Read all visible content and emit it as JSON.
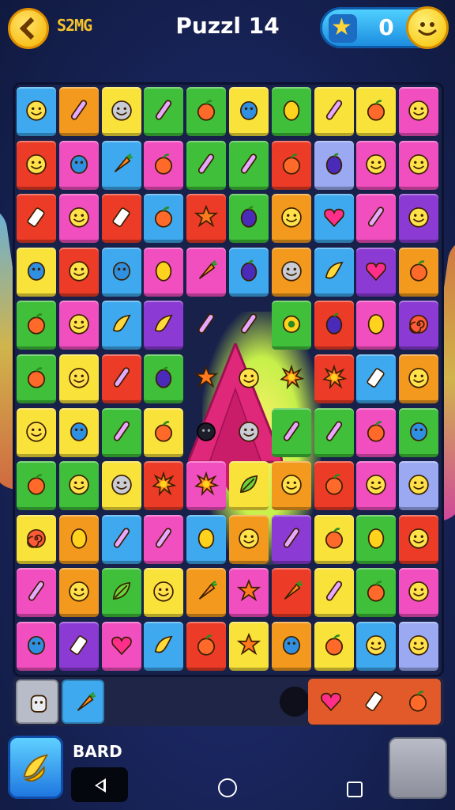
{
  "header": {
    "level_code": "S2MG",
    "title": "Puzzl 14",
    "score": "0"
  },
  "colors": {
    "blue": "#3ea9ee",
    "orange": "#f39a1e",
    "yellow": "#f9e23a",
    "green": "#3fbf3a",
    "red": "#ec3b26",
    "pink": "#f14fc0",
    "purple": "#8b3bd4",
    "lavender": "#9aa9f2",
    "gray": "#b8bcc8"
  },
  "board": {
    "rows": [
      [
        [
          "blue",
          "smiley"
        ],
        [
          "orange",
          "stick"
        ],
        [
          "yellow",
          "smiley-gray"
        ],
        [
          "green",
          "stick"
        ],
        [
          "green",
          "apple"
        ],
        [
          "yellow",
          "blob"
        ],
        [
          "green",
          "lemon"
        ],
        [
          "yellow",
          "stick"
        ],
        [
          "yellow",
          "apple"
        ],
        [
          "pink",
          "smiley"
        ]
      ],
      [
        [
          "red",
          "smiley"
        ],
        [
          "pink",
          "blob"
        ],
        [
          "blue",
          "carrot"
        ],
        [
          "pink",
          "apple"
        ],
        [
          "green",
          "stick"
        ],
        [
          "green",
          "stick"
        ],
        [
          "red",
          "apple"
        ],
        [
          "lavender",
          "plum"
        ],
        [
          "pink",
          "smiley"
        ],
        [
          "pink",
          "smiley"
        ]
      ],
      [
        [
          "red",
          "bottle"
        ],
        [
          "pink",
          "smiley"
        ],
        [
          "red",
          "bottle"
        ],
        [
          "blue",
          "apple"
        ],
        [
          "red",
          "star"
        ],
        [
          "green",
          "plum"
        ],
        [
          "orange",
          "smiley"
        ],
        [
          "blue",
          "heart"
        ],
        [
          "pink",
          "stick"
        ],
        [
          "purple",
          "smiley"
        ]
      ],
      [
        [
          "yellow",
          "blob"
        ],
        [
          "red",
          "smiley"
        ],
        [
          "blue",
          "blob"
        ],
        [
          "pink",
          "lemon"
        ],
        [
          "pink",
          "carrot"
        ],
        [
          "blue",
          "plum"
        ],
        [
          "orange",
          "smiley-gray"
        ],
        [
          "blue",
          "banana"
        ],
        [
          "purple",
          "heart"
        ],
        [
          "orange",
          "apple"
        ]
      ],
      [
        [
          "green",
          "apple"
        ],
        [
          "pink",
          "smiley"
        ],
        [
          "blue",
          "banana"
        ],
        [
          "purple",
          "banana"
        ],
        [
          "none",
          "stick"
        ],
        [
          "none",
          "stick"
        ],
        [
          "green",
          "eye"
        ],
        [
          "red",
          "plum"
        ],
        [
          "pink",
          "lemon"
        ],
        [
          "purple",
          "swirl"
        ]
      ],
      [
        [
          "green",
          "apple"
        ],
        [
          "yellow",
          "smiley"
        ],
        [
          "red",
          "stick"
        ],
        [
          "green",
          "plum"
        ],
        [
          "none",
          "star"
        ],
        [
          "none",
          "smiley"
        ],
        [
          "none",
          "flower"
        ],
        [
          "red",
          "flower"
        ],
        [
          "blue",
          "bottle"
        ],
        [
          "orange",
          "smiley"
        ]
      ],
      [
        [
          "yellow",
          "smiley"
        ],
        [
          "yellow",
          "blob"
        ],
        [
          "green",
          "stick"
        ],
        [
          "yellow",
          "apple"
        ],
        [
          "none",
          "bomb"
        ],
        [
          "none",
          "smiley-gray"
        ],
        [
          "green",
          "stick"
        ],
        [
          "green",
          "stick"
        ],
        [
          "pink",
          "apple"
        ],
        [
          "green",
          "blob"
        ]
      ],
      [
        [
          "green",
          "apple"
        ],
        [
          "green",
          "smiley"
        ],
        [
          "yellow",
          "smiley-gray"
        ],
        [
          "red",
          "flower"
        ],
        [
          "pink",
          "flower"
        ],
        [
          "yellow",
          "leaf"
        ],
        [
          "orange",
          "smiley"
        ],
        [
          "red",
          "apple"
        ],
        [
          "pink",
          "smiley"
        ],
        [
          "lavender",
          "smiley"
        ]
      ],
      [
        [
          "yellow",
          "swirl"
        ],
        [
          "orange",
          "lemon"
        ],
        [
          "blue",
          "stick"
        ],
        [
          "pink",
          "stick"
        ],
        [
          "blue",
          "lemon"
        ],
        [
          "orange",
          "smiley"
        ],
        [
          "purple",
          "stick"
        ],
        [
          "yellow",
          "apple"
        ],
        [
          "green",
          "lemon"
        ],
        [
          "red",
          "smiley"
        ]
      ],
      [
        [
          "pink",
          "stick"
        ],
        [
          "orange",
          "smiley"
        ],
        [
          "green",
          "leaf"
        ],
        [
          "yellow",
          "smiley"
        ],
        [
          "orange",
          "carrot"
        ],
        [
          "pink",
          "star"
        ],
        [
          "red",
          "carrot"
        ],
        [
          "yellow",
          "stick"
        ],
        [
          "green",
          "apple"
        ],
        [
          "pink",
          "smiley"
        ]
      ],
      [
        [
          "pink",
          "blob"
        ],
        [
          "purple",
          "bottle"
        ],
        [
          "pink",
          "heart"
        ],
        [
          "blue",
          "banana"
        ],
        [
          "red",
          "apple"
        ],
        [
          "yellow",
          "star"
        ],
        [
          "orange",
          "blob"
        ],
        [
          "yellow",
          "apple"
        ],
        [
          "blue",
          "smiley"
        ],
        [
          "lavender",
          "smiley"
        ]
      ]
    ]
  },
  "tray": {
    "left": [
      [
        "gray",
        "robot"
      ],
      [
        "blue",
        "carrot"
      ]
    ],
    "right": [
      "heart",
      "bottle",
      "apple"
    ]
  },
  "footer": {
    "board_label": "BARD",
    "booster_icon": "banana-icon"
  }
}
